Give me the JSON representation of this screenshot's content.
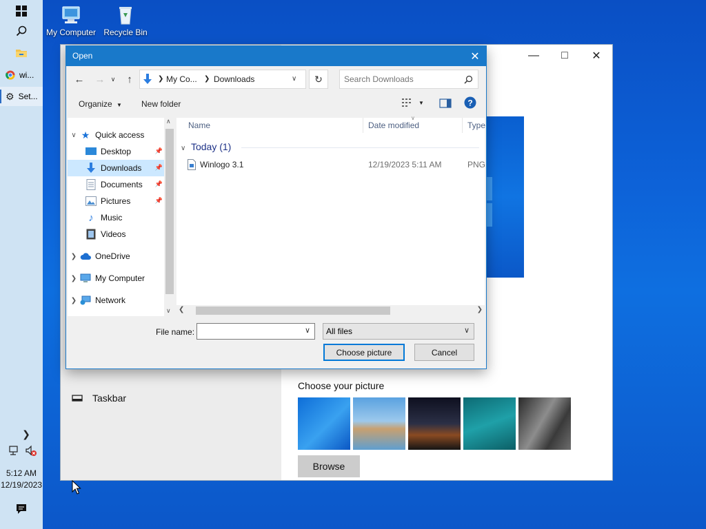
{
  "taskbar": {
    "apps": [
      {
        "label": "wi...",
        "icon": "chrome-icon"
      },
      {
        "label": "Set...",
        "icon": "gear-icon"
      }
    ],
    "clock": {
      "time": "5:12 AM",
      "date": "12/19/2023"
    }
  },
  "desktop": {
    "icons": [
      {
        "label": "My Computer"
      },
      {
        "label": "Recycle Bin"
      }
    ]
  },
  "settings": {
    "nav_item": "Taskbar",
    "choose_label": "Choose your picture",
    "browse_label": "Browse"
  },
  "dialog": {
    "title": "Open",
    "address": {
      "segments": [
        "My Co...",
        "Downloads"
      ]
    },
    "search_placeholder": "Search Downloads",
    "toolbar": {
      "organize": "Organize",
      "new_folder": "New folder"
    },
    "nav": [
      {
        "label": "Quick access",
        "icon": "star-icon"
      },
      {
        "label": "Desktop",
        "icon": "desktop-icon"
      },
      {
        "label": "Downloads",
        "icon": "download-icon"
      },
      {
        "label": "Documents",
        "icon": "documents-icon"
      },
      {
        "label": "Pictures",
        "icon": "pictures-icon"
      },
      {
        "label": "Music",
        "icon": "music-icon"
      },
      {
        "label": "Videos",
        "icon": "videos-icon"
      },
      {
        "label": "OneDrive",
        "icon": "cloud-icon"
      },
      {
        "label": "My Computer",
        "icon": "computer-icon"
      },
      {
        "label": "Network",
        "icon": "network-icon"
      }
    ],
    "columns": {
      "name": "Name",
      "date": "Date modified",
      "type": "Type"
    },
    "group": "Today (1)",
    "files": [
      {
        "name": "Winlogo 3.1",
        "date": "12/19/2023 5:11 AM",
        "type": "PNG"
      }
    ],
    "file_name_label": "File name:",
    "file_name_value": "",
    "filter_value": "All files",
    "choose_button": "Choose picture",
    "cancel_button": "Cancel"
  },
  "colors": {
    "accent": "#1979ca",
    "selection": "#cce8ff",
    "desktop": "#0d62d8"
  }
}
